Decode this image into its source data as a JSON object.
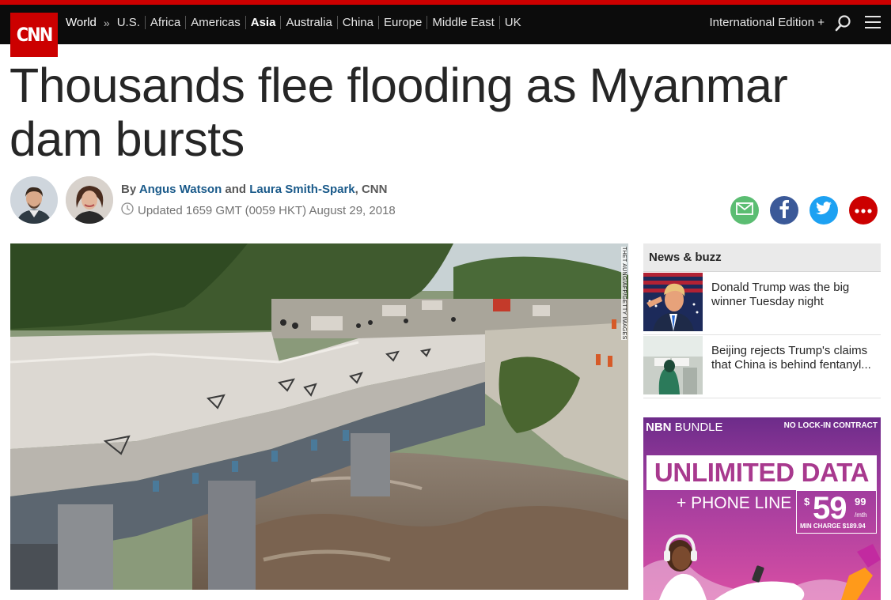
{
  "header": {
    "logo": "CNN",
    "nav_root": "World",
    "separator": "»",
    "nav_items": [
      "U.S.",
      "Africa",
      "Americas",
      "Asia",
      "Australia",
      "China",
      "Europe",
      "Middle East",
      "UK"
    ],
    "active_item": "Asia",
    "edition": "International Edition +",
    "brand_color": "#cc0000"
  },
  "article": {
    "headline": "Thousands flee flooding as Myanmar dam bursts",
    "by": "By",
    "author1": "Angus Watson",
    "and": "and",
    "author2": "Laura Smith-Spark",
    "outlet": ", CNN",
    "updated": "Updated 1659 GMT (0059 HKT) August 29, 2018",
    "image_credit": "THET AUNG/AFP/GETTY IMAGES"
  },
  "share": {
    "icons": [
      "email-icon",
      "facebook-icon",
      "twitter-icon",
      "more-icon"
    ],
    "colors": [
      "#5bbd72",
      "#3b5998",
      "#1da1f2",
      "#cc0000"
    ]
  },
  "sidebar": {
    "heading": "News & buzz",
    "items": [
      {
        "text": "Donald Trump was the big winner Tuesday night"
      },
      {
        "text": "Beijing rejects Trump's claims that China is behind fentanyl..."
      }
    ]
  },
  "ad": {
    "brand_bold": "NBN",
    "brand_rest": " BUNDLE",
    "no_lock": "NO LOCK-IN CONTRACT",
    "headline": "UNLIMITED DATA",
    "phone": "+ PHONE LINE",
    "dollar": "$",
    "price": "59",
    "cents": "99",
    "per": "/mth",
    "min_charge": "MIN CHARGE $189.94"
  }
}
